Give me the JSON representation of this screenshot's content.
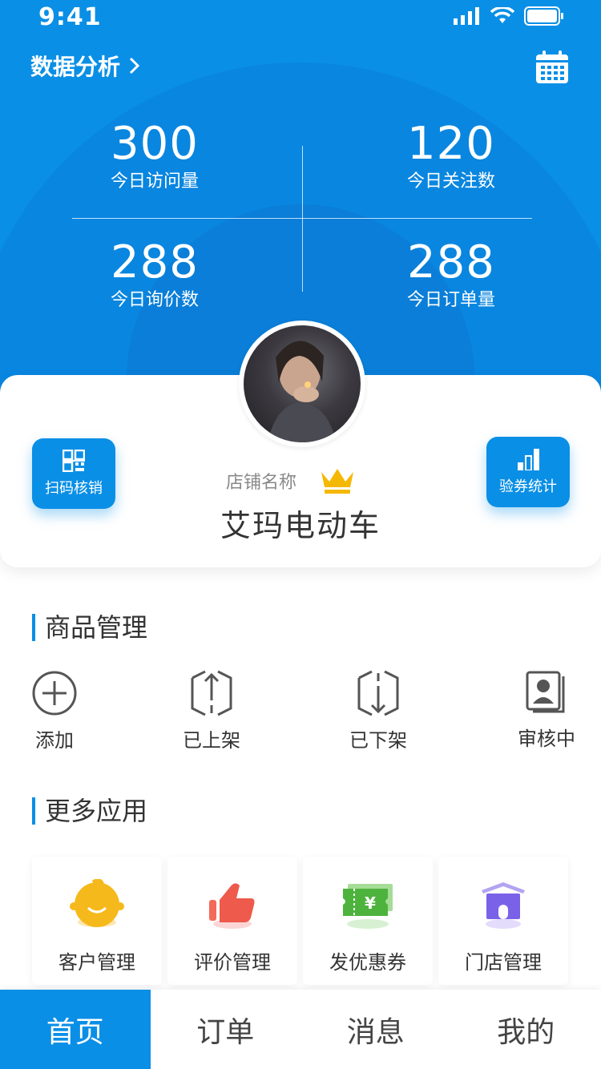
{
  "status_bar": {
    "time": "9:41"
  },
  "header": {
    "title": "数据分析",
    "stats": [
      {
        "value": "300",
        "label": "今日访问量"
      },
      {
        "value": "120",
        "label": "今日关注数"
      },
      {
        "value": "288",
        "label": "今日询价数"
      },
      {
        "value": "288",
        "label": "今日订单量"
      }
    ]
  },
  "shop": {
    "label": "店铺名称",
    "name": "艾玛电动车",
    "scan_button": "扫码核销",
    "coupon_stats_button": "验券统计"
  },
  "goods_section": {
    "title": "商品管理",
    "items": [
      {
        "label": "添加",
        "icon": "add-circle-icon"
      },
      {
        "label": "已上架",
        "icon": "shelf-up-icon"
      },
      {
        "label": "已下架",
        "icon": "shelf-down-icon"
      },
      {
        "label": "审核中",
        "icon": "reviewing-icon"
      }
    ]
  },
  "apps_section": {
    "title": "更多应用",
    "items": [
      {
        "label": "客户管理",
        "icon": "customer-icon"
      },
      {
        "label": "评价管理",
        "icon": "thumbs-up-icon"
      },
      {
        "label": "发优惠券",
        "icon": "coupon-icon"
      },
      {
        "label": "门店管理",
        "icon": "store-icon"
      }
    ]
  },
  "tabbar": {
    "tabs": [
      "首页",
      "订单",
      "消息",
      "我的"
    ],
    "active_index": 0
  },
  "colors": {
    "primary": "#0a8fe6",
    "crown": "#f5b800"
  }
}
